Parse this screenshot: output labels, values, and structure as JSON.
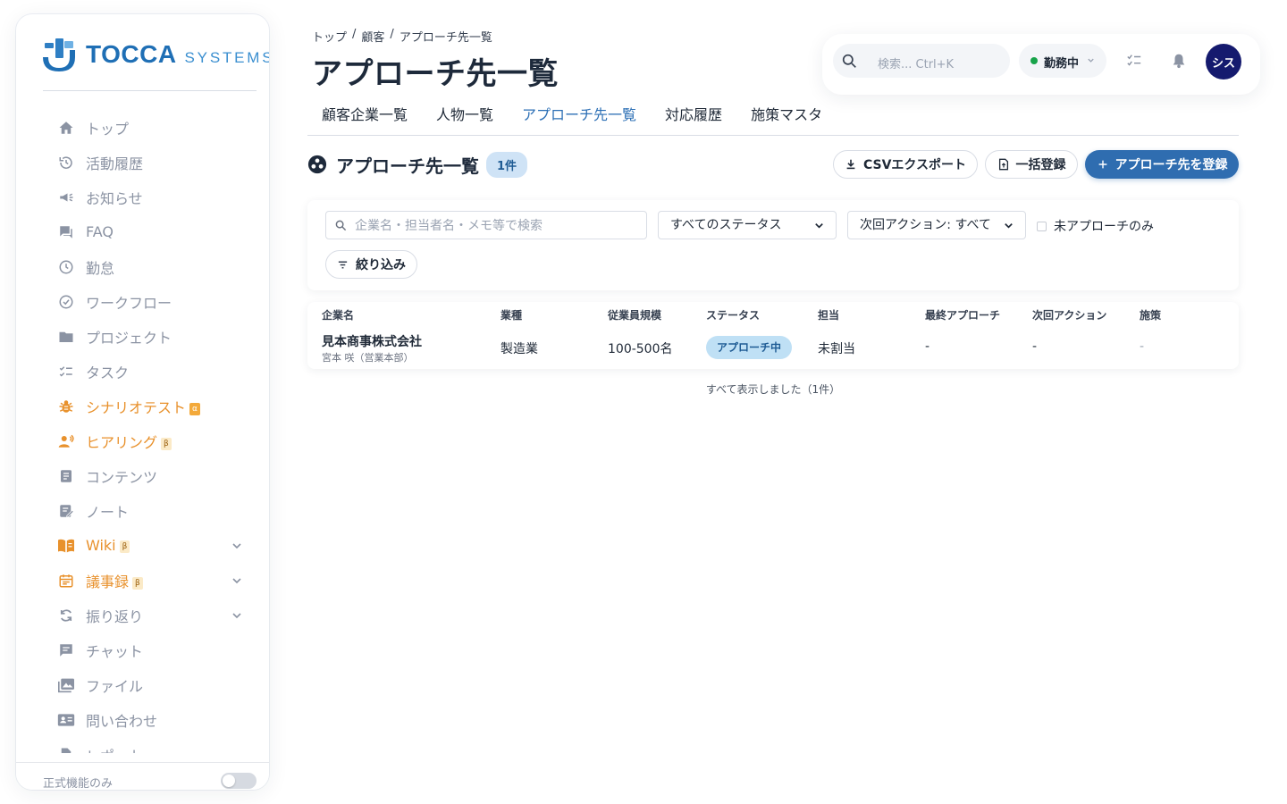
{
  "brand": {
    "name_main": "TOCCA",
    "name_sub": "SYSTEMS",
    "accent": "#2f6db0",
    "orange": "#e8912c"
  },
  "sidebar": {
    "items": [
      {
        "label": "トップ",
        "icon": "home-icon",
        "color": "gray"
      },
      {
        "label": "活動履歴",
        "icon": "history-icon",
        "color": "gray"
      },
      {
        "label": "お知らせ",
        "icon": "megaphone-icon",
        "color": "gray"
      },
      {
        "label": "FAQ",
        "icon": "faq-chat-icon",
        "color": "gray"
      },
      {
        "label": "勤怠",
        "icon": "clock-icon",
        "color": "gray"
      },
      {
        "label": "ワークフロー",
        "icon": "check-circle-icon",
        "color": "gray"
      },
      {
        "label": "プロジェクト",
        "icon": "folder-icon",
        "color": "gray"
      },
      {
        "label": "タスク",
        "icon": "checklist-icon",
        "color": "gray"
      },
      {
        "label": "シナリオテスト",
        "icon": "bug-icon",
        "color": "orange",
        "badge": "α"
      },
      {
        "label": "ヒアリング",
        "icon": "hearing-icon",
        "color": "orange",
        "badge": "β"
      },
      {
        "label": "コンテンツ",
        "icon": "document-icon",
        "color": "gray"
      },
      {
        "label": "ノート",
        "icon": "note-icon",
        "color": "gray"
      },
      {
        "label": "Wiki",
        "icon": "book-icon",
        "color": "orange",
        "badge": "β",
        "expandable": true
      },
      {
        "label": "議事録",
        "icon": "calendar-icon",
        "color": "orange",
        "badge": "β",
        "expandable": true
      },
      {
        "label": "振り返り",
        "icon": "refresh-icon",
        "color": "gray",
        "expandable": true
      },
      {
        "label": "チャット",
        "icon": "chat-icon",
        "color": "gray"
      },
      {
        "label": "ファイル",
        "icon": "images-icon",
        "color": "gray"
      },
      {
        "label": "問い合わせ",
        "icon": "contact-card-icon",
        "color": "gray"
      },
      {
        "label": "レポート",
        "icon": "report-icon",
        "color": "gray"
      }
    ],
    "footer_label": "正式機能のみ",
    "footer_toggle_on": false
  },
  "header": {
    "breadcrumb": [
      "トップ",
      "顧客",
      "アプローチ先一覧"
    ],
    "breadcrumb_sep": "/",
    "title": "アプローチ先一覧",
    "search_placeholder": "検索... Ctrl+K",
    "work_status": "勤務中",
    "avatar_text": "シス"
  },
  "tabs": [
    {
      "label": "顧客企業一覧",
      "active": false
    },
    {
      "label": "人物一覧",
      "active": false
    },
    {
      "label": "アプローチ先一覧",
      "active": true
    },
    {
      "label": "対応履歴",
      "active": false
    },
    {
      "label": "施策マスタ",
      "active": false
    }
  ],
  "section": {
    "title": "アプローチ先一覧",
    "count": "1件",
    "csv_button": "CSVエクスポート",
    "bulk_button": "一括登録",
    "register_button": "アプローチ先を登録"
  },
  "filters": {
    "search_placeholder": "企業名・担当者名・メモ等で検索",
    "status_select": "すべてのステータス",
    "next_action_select": "次回アクション: すべて",
    "unapproached_label": "未アプローチのみ",
    "unapproached_checked": false,
    "narrow_button": "絞り込み"
  },
  "table": {
    "columns": [
      "企業名",
      "業種",
      "従業員規模",
      "ステータス",
      "担当",
      "最終アプローチ",
      "次回アクション",
      "施策"
    ],
    "rows": [
      {
        "company": "見本商事株式会社",
        "contact": "宮本 咲（営業本部）",
        "industry": "製造業",
        "size": "100-500名",
        "status": "アプローチ中",
        "assignee": "未割当",
        "last_approach": "-",
        "next_action": "-",
        "measure": "-"
      }
    ],
    "footer": "すべて表示しました（1件）"
  }
}
